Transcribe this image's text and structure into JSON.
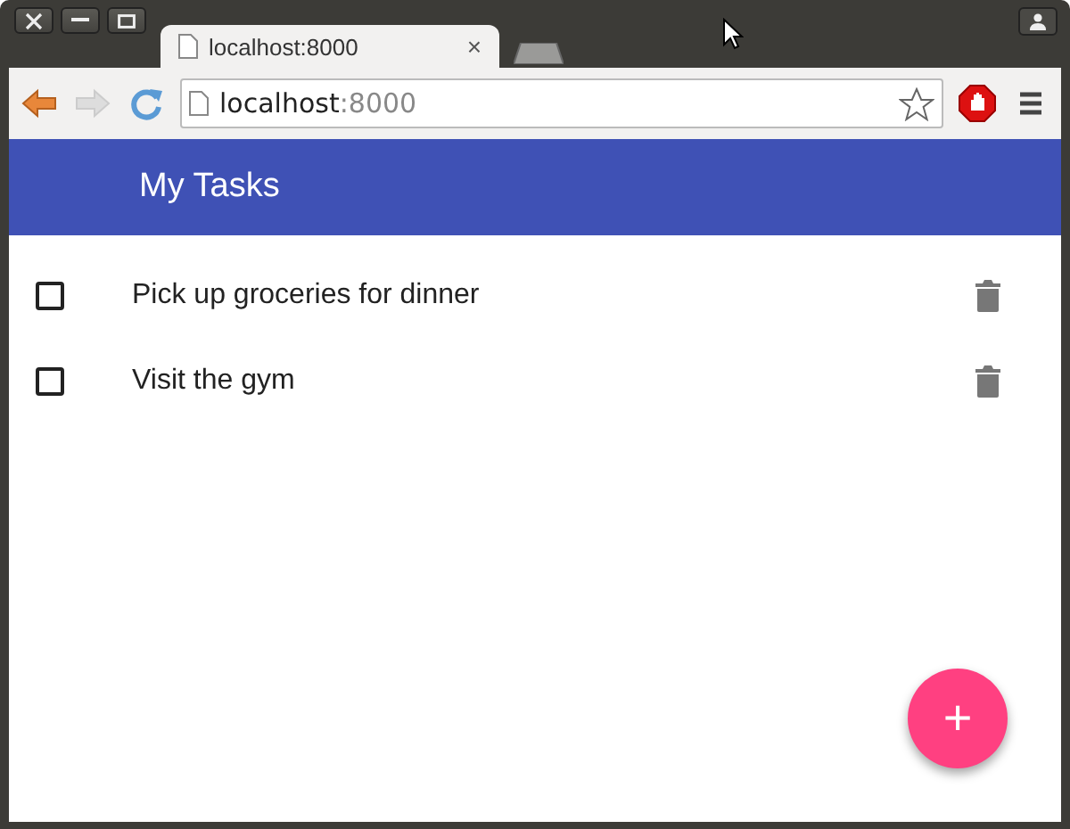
{
  "tab": {
    "title": "localhost:8000",
    "close": "×",
    "selected": true
  },
  "address_bar": {
    "host": "localhost",
    "port": ":8000"
  },
  "app_bar": {
    "title": "My Tasks"
  },
  "tasks": [
    {
      "text": "Pick up groceries for dinner",
      "checked": false
    },
    {
      "text": "Visit the gym",
      "checked": false
    }
  ],
  "fab": {
    "label": "+"
  }
}
